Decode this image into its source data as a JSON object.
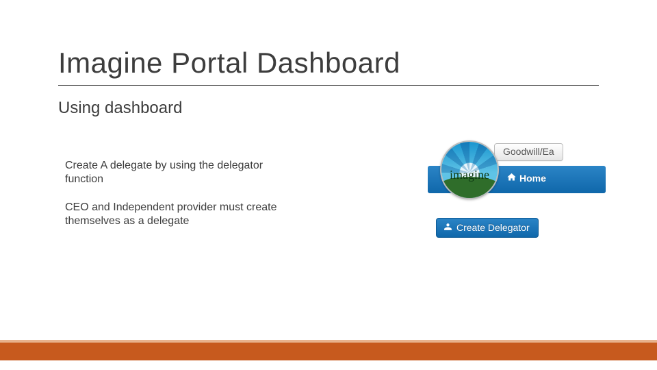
{
  "title": "Imagine Portal Dashboard",
  "subtitle": "Using dashboard",
  "body1": "Create A delegate by using the delegator function",
  "body2": "CEO and Independent provider must create themselves as a delegate",
  "snippet": {
    "tag_label": "Goodwill/Ea",
    "home_label": "Home",
    "logo_word": "imagine",
    "delegator_label": "Create Delegator"
  }
}
